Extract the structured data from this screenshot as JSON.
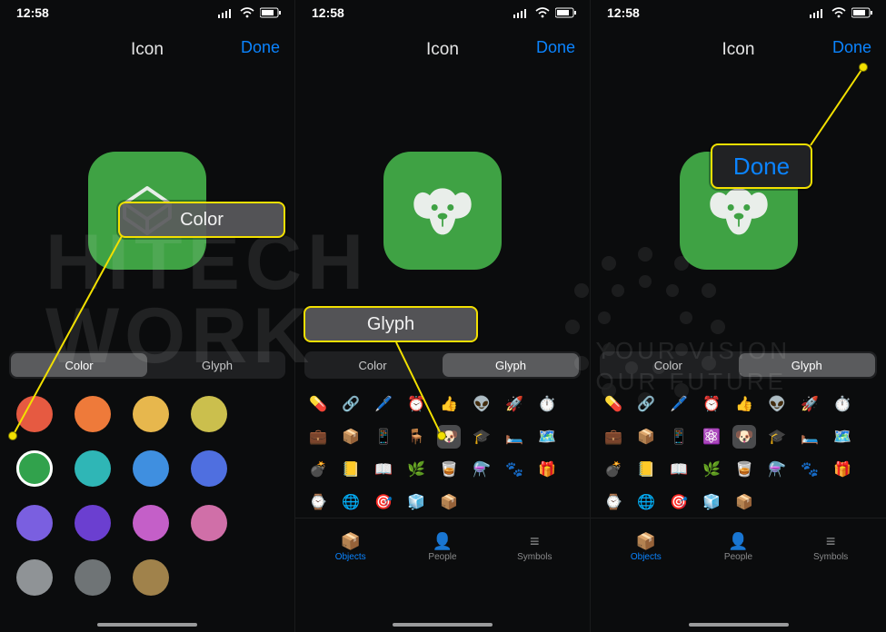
{
  "status": {
    "time": "12:58"
  },
  "nav": {
    "title": "Icon",
    "done": "Done"
  },
  "segmented": {
    "color": "Color",
    "glyph": "Glyph"
  },
  "callouts": {
    "color": "Color",
    "glyph": "Glyph",
    "done": "Done"
  },
  "pane1": {
    "active_tab": "color",
    "colors": [
      "#e65a41",
      "#ee7a3a",
      "#e7b74d",
      "#cbbf4d",
      "#31a24c",
      "#2fb6b6",
      "#3f8fe0",
      "#4f6fe0",
      "#7a5fe0",
      "#6b3fd0",
      "#c45fc8",
      "#d06fa8",
      "#8f9396",
      "#6f7476",
      "#a0824b"
    ],
    "selected_color_index": 4
  },
  "pane2": {
    "active_tab": "glyph",
    "glyphs": [
      "💊",
      "🔗",
      "🖊️",
      "⏰",
      "👍",
      "👽",
      "🚀",
      "⏱️",
      "💼",
      "📦",
      "📱",
      "🪑",
      "🐶",
      "🎓",
      "🛏️",
      "🗺️",
      "💣",
      "📒",
      "📖",
      "🌿",
      "🥃",
      "⚗️",
      "🐾",
      "🎁",
      "⌚",
      "🌐",
      "🎯",
      "🧊",
      "📦"
    ],
    "selected_glyph_index": 12,
    "categories": [
      {
        "label": "Objects",
        "icon": "📦"
      },
      {
        "label": "People",
        "icon": "👤"
      },
      {
        "label": "Symbols",
        "icon": "≡"
      }
    ],
    "selected_category_index": 0
  },
  "pane3": {
    "active_tab": "glyph",
    "glyphs": [
      "💊",
      "🔗",
      "🖊️",
      "⏰",
      "👍",
      "👽",
      "🚀",
      "⏱️",
      "💼",
      "📦",
      "📱",
      "⚛️",
      "🐶",
      "🎓",
      "🛏️",
      "🗺️",
      "💣",
      "📒",
      "📖",
      "🌿",
      "🥃",
      "⚗️",
      "🐾",
      "🎁",
      "⌚",
      "🌐",
      "🎯",
      "🧊",
      "📦"
    ],
    "selected_glyph_index": 12,
    "categories": [
      {
        "label": "Objects",
        "icon": "📦"
      },
      {
        "label": "People",
        "icon": "👤"
      },
      {
        "label": "Symbols",
        "icon": "≡"
      }
    ],
    "selected_category_index": 0
  },
  "watermark": {
    "brand_line1": "HITECH",
    "brand_line2": "WORK",
    "tag1": "YOUR VISION",
    "tag2": "OUR FUTURE"
  }
}
